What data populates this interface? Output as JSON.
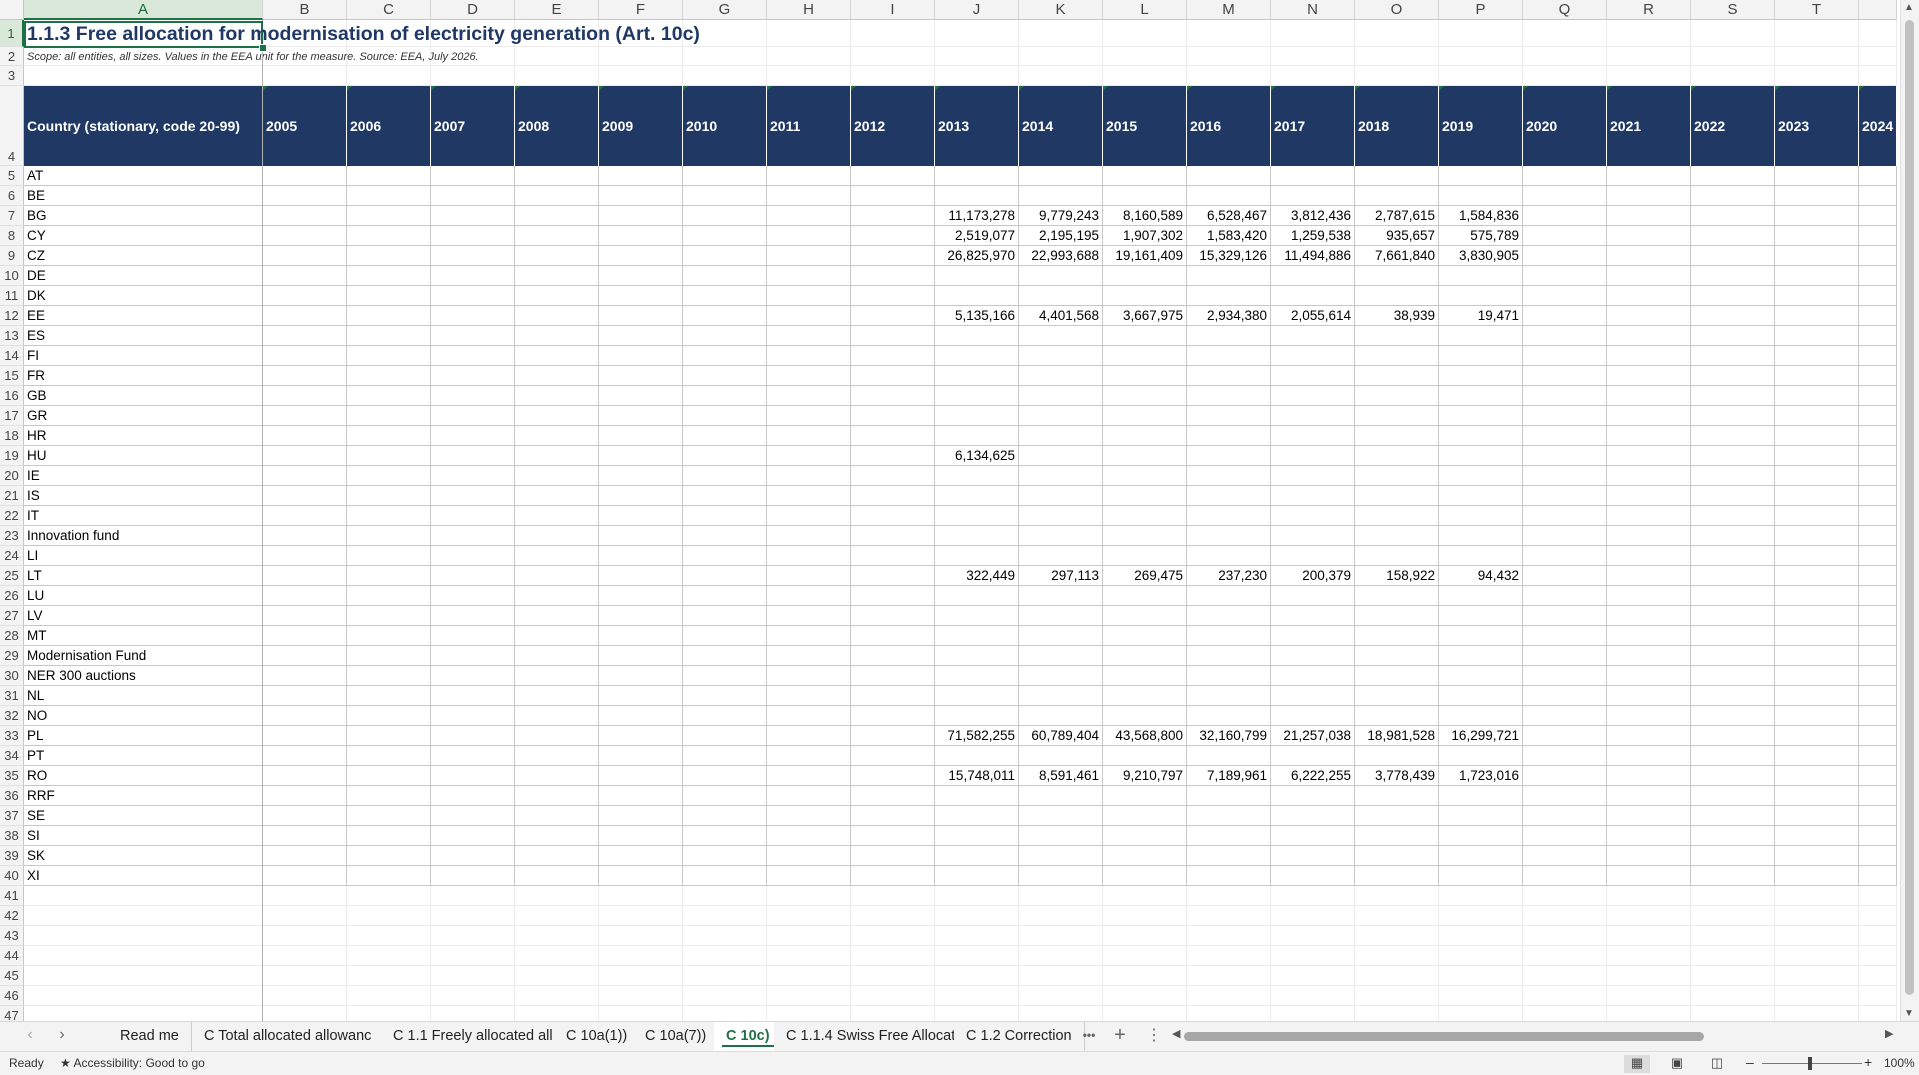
{
  "sheet": {
    "title": "1.1.3 Free allocation for modernisation of electricity generation (Art. 10c)",
    "subtitle": "Scope: all entities, all sizes. Values in the EEA unit for the measure. Source: EEA, July 2026.",
    "columns": [
      "A",
      "B",
      "C",
      "D",
      "E",
      "F",
      "G",
      "H",
      "I",
      "J",
      "K",
      "L",
      "M",
      "N",
      "O",
      "P",
      "Q",
      "R",
      "S",
      "T"
    ],
    "table_header": {
      "country_label": "Country (stationary, code 20-99)",
      "years": [
        "2005",
        "2006",
        "2007",
        "2008",
        "2009",
        "2010",
        "2011",
        "2012",
        "2013",
        "2014",
        "2015",
        "2016",
        "2017",
        "2018",
        "2019",
        "2020",
        "2021",
        "2022",
        "2023",
        "2024"
      ]
    },
    "rows": [
      {
        "country": "AT",
        "values": []
      },
      {
        "country": "BE",
        "values": []
      },
      {
        "country": "BG",
        "values": [
          "",
          "",
          "",
          "",
          "",
          "",
          "",
          "",
          "11,173,278",
          "9,779,243",
          "8,160,589",
          "6,528,467",
          "3,812,436",
          "2,787,615",
          "1,584,836"
        ]
      },
      {
        "country": "CY",
        "values": [
          "",
          "",
          "",
          "",
          "",
          "",
          "",
          "",
          "2,519,077",
          "2,195,195",
          "1,907,302",
          "1,583,420",
          "1,259,538",
          "935,657",
          "575,789"
        ]
      },
      {
        "country": "CZ",
        "values": [
          "",
          "",
          "",
          "",
          "",
          "",
          "",
          "",
          "26,825,970",
          "22,993,688",
          "19,161,409",
          "15,329,126",
          "11,494,886",
          "7,661,840",
          "3,830,905"
        ]
      },
      {
        "country": "DE",
        "values": []
      },
      {
        "country": "DK",
        "values": []
      },
      {
        "country": "EE",
        "values": [
          "",
          "",
          "",
          "",
          "",
          "",
          "",
          "",
          "5,135,166",
          "4,401,568",
          "3,667,975",
          "2,934,380",
          "2,055,614",
          "38,939",
          "19,471"
        ]
      },
      {
        "country": "ES",
        "values": []
      },
      {
        "country": "FI",
        "values": []
      },
      {
        "country": "FR",
        "values": []
      },
      {
        "country": "GB",
        "values": []
      },
      {
        "country": "GR",
        "values": []
      },
      {
        "country": "HR",
        "values": []
      },
      {
        "country": "HU",
        "values": [
          "",
          "",
          "",
          "",
          "",
          "",
          "",
          "",
          "6,134,625"
        ]
      },
      {
        "country": "IE",
        "values": []
      },
      {
        "country": "IS",
        "values": []
      },
      {
        "country": "IT",
        "values": []
      },
      {
        "country": "Innovation fund",
        "values": []
      },
      {
        "country": "LI",
        "values": []
      },
      {
        "country": "LT",
        "values": [
          "",
          "",
          "",
          "",
          "",
          "",
          "",
          "",
          "322,449",
          "297,113",
          "269,475",
          "237,230",
          "200,379",
          "158,922",
          "94,432"
        ]
      },
      {
        "country": "LU",
        "values": []
      },
      {
        "country": "LV",
        "values": []
      },
      {
        "country": "MT",
        "values": []
      },
      {
        "country": "Modernisation Fund",
        "values": []
      },
      {
        "country": "NER 300 auctions",
        "values": []
      },
      {
        "country": "NL",
        "values": []
      },
      {
        "country": "NO",
        "values": []
      },
      {
        "country": "PL",
        "values": [
          "",
          "",
          "",
          "",
          "",
          "",
          "",
          "",
          "71,582,255",
          "60,789,404",
          "43,568,800",
          "32,160,799",
          "21,257,038",
          "18,981,528",
          "16,299,721"
        ]
      },
      {
        "country": "PT",
        "values": []
      },
      {
        "country": "RO",
        "values": [
          "",
          "",
          "",
          "",
          "",
          "",
          "",
          "",
          "15,748,011",
          "8,591,461",
          "9,210,797",
          "7,189,961",
          "6,222,255",
          "3,778,439",
          "1,723,016"
        ]
      },
      {
        "country": "RRF",
        "values": []
      },
      {
        "country": "SE",
        "values": []
      },
      {
        "country": "SI",
        "values": []
      },
      {
        "country": "SK",
        "values": []
      },
      {
        "country": "XI",
        "values": []
      }
    ]
  },
  "tabs": [
    {
      "label": "Read me",
      "active": false
    },
    {
      "label": "C Total allocated allowanc",
      "active": false
    },
    {
      "label": "C 1.1 Freely allocated all",
      "active": false
    },
    {
      "label": "C 10a(1))",
      "active": false
    },
    {
      "label": "C 10a(7))",
      "active": false
    },
    {
      "label": "C 10c)",
      "active": true
    },
    {
      "label": "C 1.1.4 Swiss Free Allocat",
      "active": false
    },
    {
      "label": "C 1.2 Correction",
      "active": false
    }
  ],
  "tab_more": "•••",
  "tab_add": "+",
  "status": {
    "ready": "Ready",
    "accessibility": "Accessibility: Good to go",
    "zoom": "100%"
  }
}
